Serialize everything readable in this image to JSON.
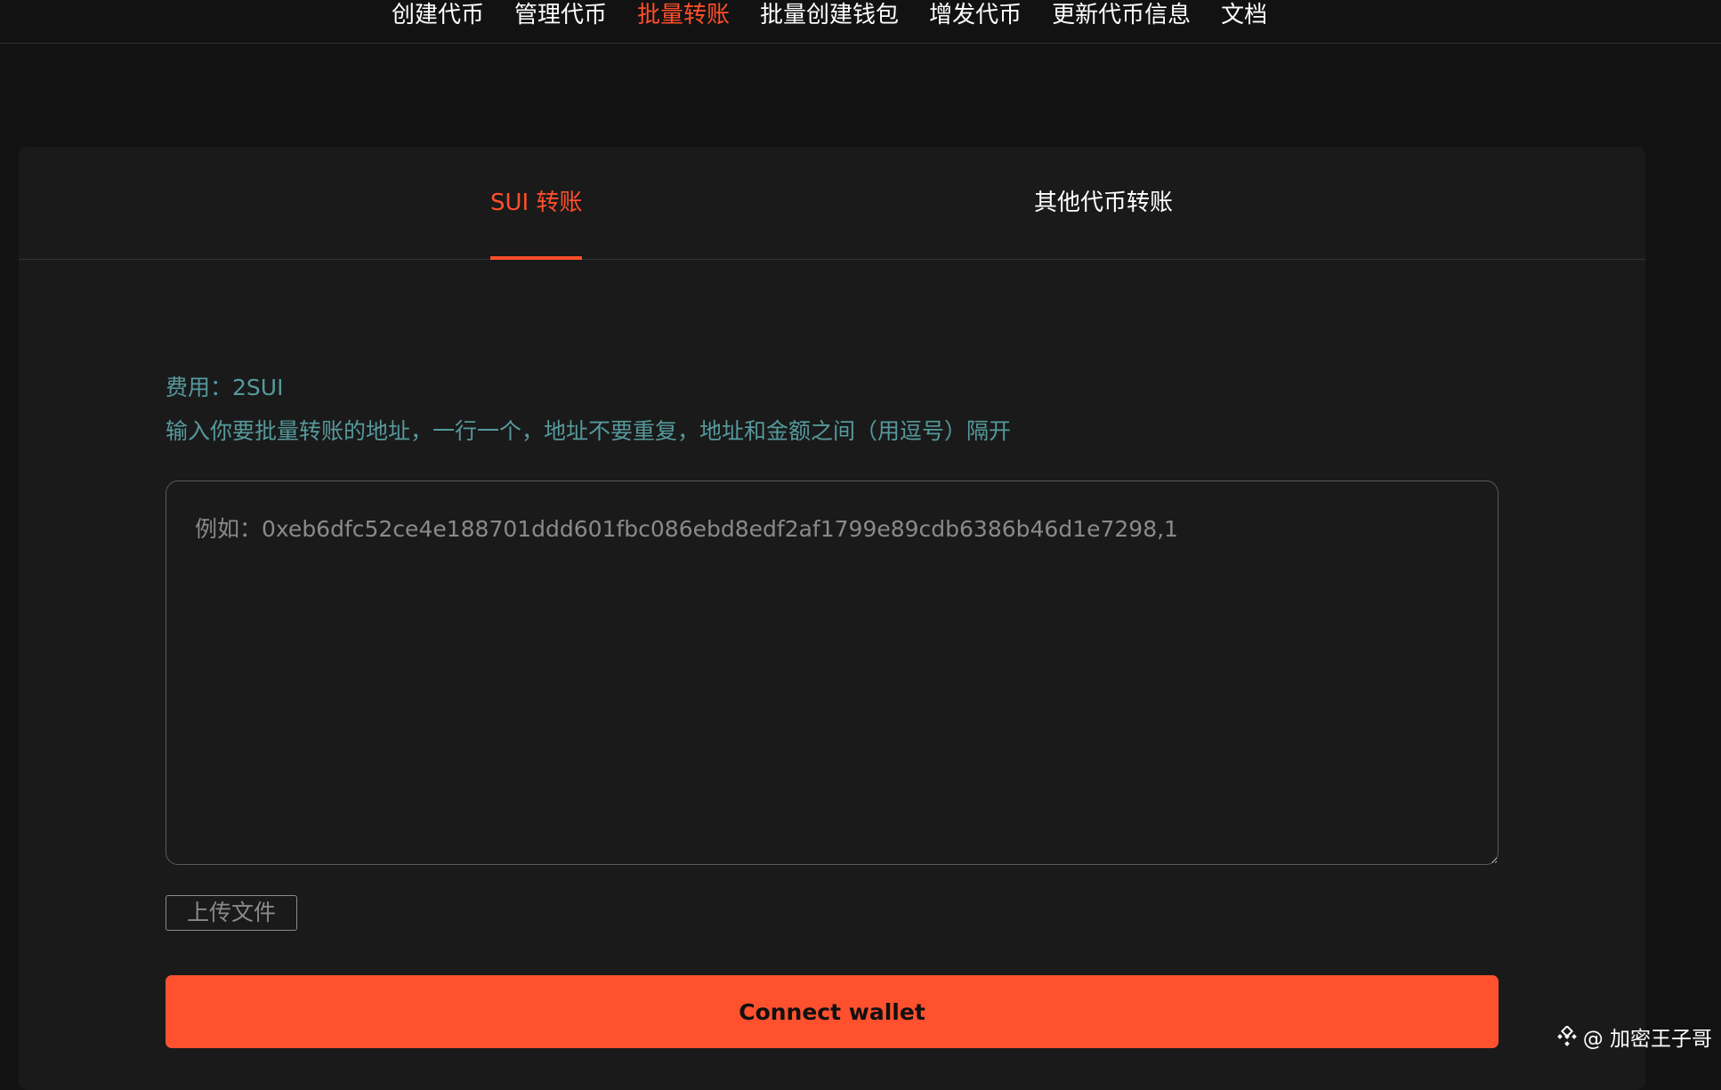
{
  "nav": {
    "items": [
      {
        "label": "创建代币",
        "active": false
      },
      {
        "label": "管理代币",
        "active": false
      },
      {
        "label": "批量转账",
        "active": true
      },
      {
        "label": "批量创建钱包",
        "active": false
      },
      {
        "label": "增发代币",
        "active": false
      },
      {
        "label": "更新代币信息",
        "active": false
      },
      {
        "label": "文档",
        "active": false
      }
    ]
  },
  "tabs": [
    {
      "label": "SUI 转账",
      "active": true
    },
    {
      "label": "其他代币转账",
      "active": false
    }
  ],
  "form": {
    "fee": "费用：2SUI",
    "description": "输入你要批量转账的地址，一行一个，地址不要重复，地址和金额之间（用逗号）隔开",
    "placeholder": "例如：0xeb6dfc52ce4e188701ddd601fbc086ebd8edf2af1799e89cdb6386b46d1e7298,1",
    "value": "",
    "upload_label": "上传文件",
    "connect_label": "Connect wallet"
  },
  "watermark": {
    "text": "@ 加密王子哥",
    "icon": "binance-square-icon"
  },
  "colors": {
    "accent": "#ff512e",
    "hint": "#56999c",
    "background": "#121212",
    "card": "#1a1a1a"
  }
}
